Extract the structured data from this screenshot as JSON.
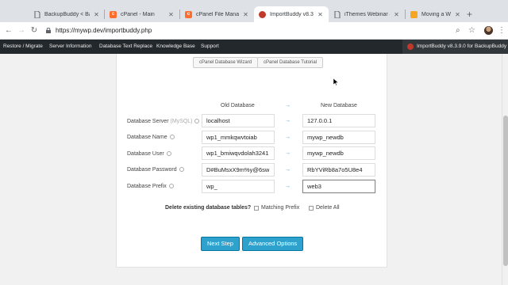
{
  "browser": {
    "tabs": [
      {
        "title": "BackupBuddy < Back",
        "icon": "page-icon",
        "active": false
      },
      {
        "title": "cPanel - Main",
        "icon": "cpanel-icon",
        "active": false
      },
      {
        "title": "cPanel File Manager",
        "icon": "cpanel-icon",
        "active": false
      },
      {
        "title": "ImportBuddy v8.3.9",
        "icon": "importbuddy-icon",
        "active": true
      },
      {
        "title": "iThemes Webinar – Ju",
        "icon": "page-icon",
        "active": false
      },
      {
        "title": "Moving a Website wi",
        "icon": "bookmark-icon",
        "active": false
      }
    ],
    "url": "https://mywp.dev/importbuddy.php"
  },
  "adminbar": {
    "menu": [
      "Restore / Migrate",
      "Server Information",
      "Database Text Replace",
      "Knowledge Base",
      "Support"
    ],
    "brand": "ImportBuddy v8.3.9.0 for BackupBuddy"
  },
  "tutorials": {
    "wizard": "cPanel Database Wizard",
    "tutorial": "cPanel Database Tutorial"
  },
  "db": {
    "old_header": "Old Database",
    "new_header": "New Database",
    "arrow": "→",
    "rows": [
      {
        "label": "Database Server",
        "muted": "(MySQL)",
        "old": "localhost",
        "new": "127.0.0.1"
      },
      {
        "label": "Database Name",
        "muted": "",
        "old": "wp1_mmkqwvtoiab",
        "new": "mywp_newdb"
      },
      {
        "label": "Database User",
        "muted": "",
        "old": "wp1_bmiwqvdolah3241",
        "new": "mywp_newdb"
      },
      {
        "label": "Database Password",
        "muted": "",
        "old": "D#BuMsxX9m%y@6sw",
        "new": "RbYViRb8a7o5U8e4"
      },
      {
        "label": "Database Prefix",
        "muted": "",
        "old": "wp_",
        "new": "web3"
      }
    ]
  },
  "delete": {
    "label": "Delete existing database tables?",
    "option_prefix": "Matching Prefix",
    "option_all": "Delete All"
  },
  "actions": {
    "next": "Next Step",
    "advanced": "Advanced Options"
  },
  "colors": {
    "accent": "#2ea2cc",
    "adminbar": "#23282d"
  }
}
